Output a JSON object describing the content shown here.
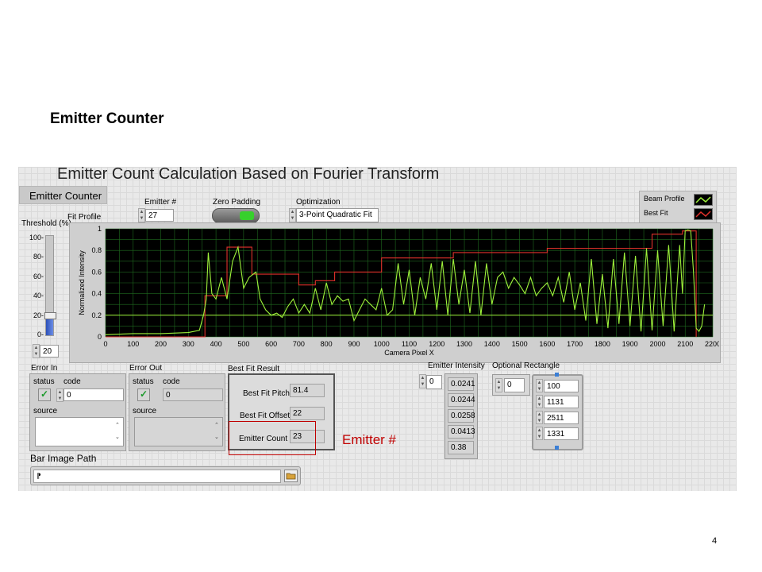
{
  "slide": {
    "title": "Emitter Counter",
    "page_number": "4"
  },
  "panel": {
    "title": "Emitter Count Calculation Based on Fourier Transform",
    "tab_label": "Emitter Counter"
  },
  "controls": {
    "emitter_num_label": "Emitter #",
    "emitter_num_value": "27",
    "zero_padding_label": "Zero Padding",
    "optimization_label": "Optimization",
    "optimization_value": "3-Point Quadratic Fit",
    "fit_profile_label": "Fit Profile",
    "threshold_label": "Threshold (%)",
    "threshold_ticks": [
      "100-",
      "80-",
      "60-",
      "40-",
      "20-",
      "0-"
    ],
    "threshold_value": "20",
    "threshold_level_fraction": 0.2
  },
  "legend": {
    "items": [
      "Beam Profile",
      "Best Fit"
    ]
  },
  "chart_data": {
    "type": "line",
    "xlabel": "Camera Pixel X",
    "ylabel": "Normalized Intensity",
    "xlim": [
      0,
      2200
    ],
    "ylim": [
      0,
      1
    ],
    "x_ticks": [
      "0",
      "100",
      "200",
      "300",
      "400",
      "500",
      "600",
      "700",
      "800",
      "900",
      "1000",
      "1100",
      "1200",
      "1300",
      "1400",
      "1500",
      "1600",
      "1700",
      "1800",
      "1900",
      "2000",
      "2100",
      "2200"
    ],
    "y_ticks": [
      "0",
      "0.2",
      "0.4",
      "0.6",
      "0.8",
      "1"
    ],
    "threshold_line": 0.2,
    "colors": {
      "background": "#000000",
      "grid": "#1f6b1f",
      "beam": "#9ef23b",
      "fit": "#e0312b"
    },
    "series": [
      {
        "name": "Best Fit",
        "x": [
          0,
          360,
          360,
          440,
          440,
          530,
          530,
          700,
          700,
          760,
          760,
          830,
          830,
          1000,
          1000,
          1260,
          1260,
          1600,
          1600,
          1980,
          1980,
          2090,
          2090,
          2140,
          2140
        ],
        "y": [
          0,
          0,
          0.38,
          0.38,
          0.83,
          0.83,
          0.58,
          0.58,
          0.48,
          0.48,
          0.52,
          0.52,
          0.6,
          0.6,
          0.73,
          0.73,
          0.78,
          0.78,
          0.82,
          0.82,
          0.95,
          0.95,
          0.98,
          0.98,
          0
        ]
      },
      {
        "name": "Beam Profile",
        "x": [
          0,
          100,
          200,
          300,
          340,
          355,
          365,
          372,
          385,
          400,
          420,
          440,
          460,
          480,
          500,
          520,
          545,
          560,
          580,
          600,
          620,
          640,
          660,
          680,
          700,
          720,
          740,
          760,
          780,
          800,
          820,
          840,
          860,
          880,
          900,
          920,
          940,
          960,
          980,
          1000,
          1020,
          1040,
          1060,
          1080,
          1100,
          1120,
          1140,
          1160,
          1180,
          1200,
          1220,
          1240,
          1260,
          1280,
          1300,
          1320,
          1340,
          1360,
          1380,
          1400,
          1420,
          1440,
          1460,
          1480,
          1500,
          1520,
          1540,
          1560,
          1580,
          1600,
          1620,
          1640,
          1660,
          1680,
          1700,
          1720,
          1740,
          1760,
          1780,
          1800,
          1820,
          1840,
          1860,
          1880,
          1900,
          1920,
          1940,
          1960,
          1980,
          2000,
          2020,
          2040,
          2060,
          2080,
          2090,
          2100,
          2110,
          2120,
          2130,
          2140,
          2150,
          2160,
          2170
        ],
        "y": [
          0.02,
          0.03,
          0.03,
          0.04,
          0.06,
          0.2,
          0.35,
          0.78,
          0.4,
          0.35,
          0.55,
          0.35,
          0.7,
          0.83,
          0.45,
          0.55,
          0.6,
          0.35,
          0.25,
          0.2,
          0.22,
          0.18,
          0.28,
          0.35,
          0.22,
          0.3,
          0.22,
          0.45,
          0.25,
          0.5,
          0.3,
          0.38,
          0.33,
          0.35,
          0.15,
          0.25,
          0.35,
          0.3,
          0.25,
          0.45,
          0.2,
          0.25,
          0.68,
          0.3,
          0.62,
          0.2,
          0.55,
          0.35,
          0.68,
          0.25,
          0.7,
          0.2,
          0.72,
          0.3,
          0.62,
          0.22,
          0.7,
          0.2,
          0.68,
          0.3,
          0.55,
          0.6,
          0.45,
          0.55,
          0.48,
          0.4,
          0.55,
          0.38,
          0.45,
          0.5,
          0.38,
          0.55,
          0.32,
          0.6,
          0.25,
          0.5,
          0.15,
          0.72,
          0.12,
          0.58,
          0.08,
          0.72,
          0.12,
          0.78,
          0.1,
          0.75,
          0.05,
          0.82,
          0.06,
          0.8,
          0.1,
          0.85,
          0.05,
          0.85,
          0.4,
          0.98,
          0.99,
          0.98,
          0.6,
          0.08,
          0.05,
          0.1,
          0.3
        ]
      }
    ]
  },
  "error_in": {
    "title": "Error In",
    "status_label": "status",
    "code_label": "code",
    "code_value": "0",
    "source_label": "source"
  },
  "error_out": {
    "title": "Error Out",
    "status_label": "status",
    "code_label": "code",
    "code_value": "0",
    "source_label": "source"
  },
  "best_fit": {
    "title": "Best Fit Result",
    "pitch_label": "Best Fit Pitch",
    "pitch_value": "81.4",
    "offset_label": "Best Fit Offset",
    "offset_value": "22",
    "count_label": "Emitter Count",
    "count_value": "23"
  },
  "annotation": {
    "text": "Emitter #",
    "color": "#c00000"
  },
  "emitter_intensity": {
    "title": "Emitter Intensity",
    "index_value": "0",
    "values": [
      "0.0241",
      "0.0244",
      "0.0258",
      "0.0413",
      "0.38"
    ]
  },
  "optional_rectangle": {
    "title": "Optional Rectangle",
    "index_value": "0",
    "values": [
      "100",
      "1131",
      "2511",
      "1331"
    ]
  },
  "bar_image_path": {
    "label": "Bar Image Path",
    "value": "",
    "prefix_icon": "path-icon",
    "browse_icon": "folder-icon"
  }
}
